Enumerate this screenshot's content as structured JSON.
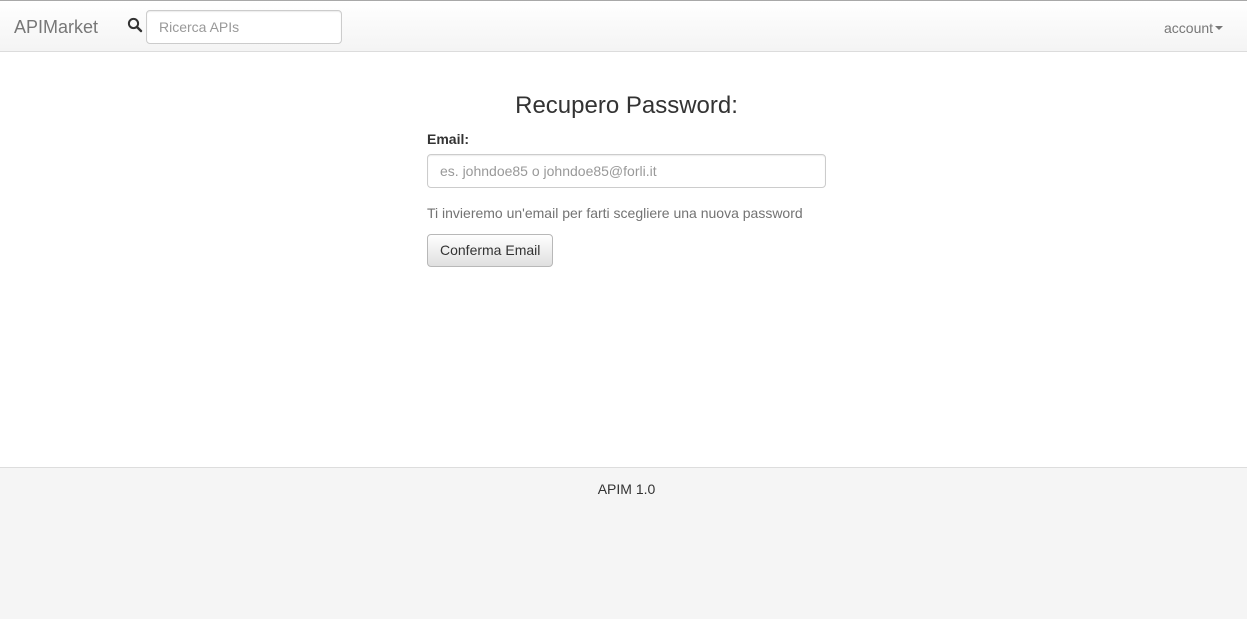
{
  "navbar": {
    "brand": "APIMarket",
    "search_icon": "search-icon",
    "search_placeholder": "Ricerca APIs",
    "account_label": "account"
  },
  "main": {
    "title": "Recupero Password:",
    "email_label": "Email:",
    "email_placeholder": "es. johndoe85 o johndoe85@forli.it",
    "help_text": "Ti invieremo un'email per farti scegliere una nuova password",
    "confirm_button": "Conferma Email"
  },
  "footer": {
    "version_text": "APIM 1.0"
  }
}
